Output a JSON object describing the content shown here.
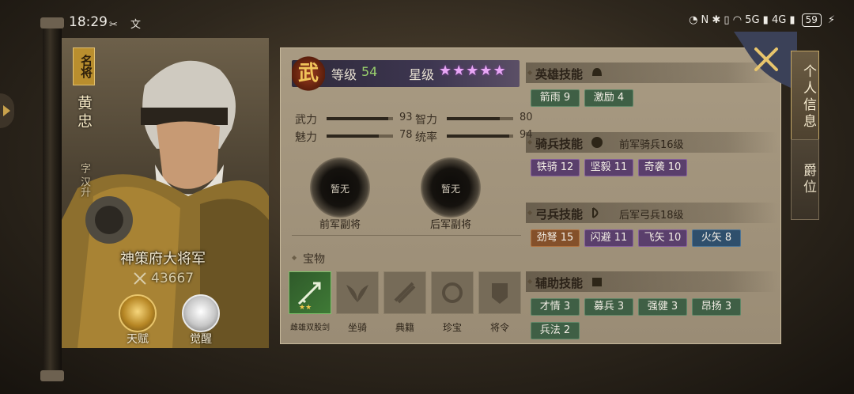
{
  "status_bar": {
    "time": "18:29",
    "left_icons": "✂ 文",
    "right_icons": "◔ N ✱ ▯ ◠ 5G ▮ 4G ▮",
    "battery": "59"
  },
  "hero": {
    "rank_tag": "名将",
    "name": "黄忠",
    "courtesy": "字 汉升",
    "title": "神策府大将军",
    "power": "43667",
    "talent_label": "天赋",
    "awaken_label": "觉醒"
  },
  "level": {
    "badge_char": "武",
    "level_label": "等级",
    "level_value": "54",
    "star_label": "星级",
    "stars": "★★★★★"
  },
  "stats": [
    {
      "label": "武力",
      "value": "93",
      "fraction": 0.93
    },
    {
      "label": "智力",
      "value": "80",
      "fraction": 0.8
    },
    {
      "label": "魅力",
      "value": "78",
      "fraction": 0.78
    },
    {
      "label": "统率",
      "value": "94",
      "fraction": 0.94
    }
  ],
  "vice_generals": [
    {
      "state": "暂无",
      "caption": "前军副将"
    },
    {
      "state": "暂无",
      "caption": "后军副将"
    }
  ],
  "treasure": {
    "title": "宝物",
    "slots": [
      {
        "caption": "雌雄双股剑",
        "stars": "★★",
        "equipped": true
      },
      {
        "caption": "坐骑",
        "equipped": false
      },
      {
        "caption": "典籍",
        "equipped": false
      },
      {
        "caption": "珍宝",
        "equipped": false
      },
      {
        "caption": "将令",
        "equipped": false
      }
    ]
  },
  "skills": {
    "hero": {
      "title": "英雄技能",
      "sub": "",
      "chips": [
        {
          "text": "箭雨 9",
          "color": "green"
        },
        {
          "text": "激励 4",
          "color": "green"
        }
      ]
    },
    "cavalry": {
      "title": "骑兵技能",
      "sub": "前军骑兵16级",
      "chips": [
        {
          "text": "铁骑 12",
          "color": "purple"
        },
        {
          "text": "坚毅 11",
          "color": "purple"
        },
        {
          "text": "奇袭 10",
          "color": "purple"
        }
      ]
    },
    "archer": {
      "title": "弓兵技能",
      "sub": "后军弓兵18级",
      "chips": [
        {
          "text": "劲弩 15",
          "color": "orange"
        },
        {
          "text": "闪避 11",
          "color": "purple"
        },
        {
          "text": "飞矢 10",
          "color": "purple"
        },
        {
          "text": "火矢 8",
          "color": "blue"
        }
      ]
    },
    "support": {
      "title": "辅助技能",
      "sub": "",
      "chips": [
        {
          "text": "才情 3",
          "color": "green"
        },
        {
          "text": "募兵 3",
          "color": "green"
        },
        {
          "text": "强健 3",
          "color": "green"
        },
        {
          "text": "昂扬 3",
          "color": "green"
        },
        {
          "text": "兵法 2",
          "color": "green"
        }
      ]
    }
  },
  "tabs": {
    "info": "个人信息",
    "rank": "爵位"
  }
}
